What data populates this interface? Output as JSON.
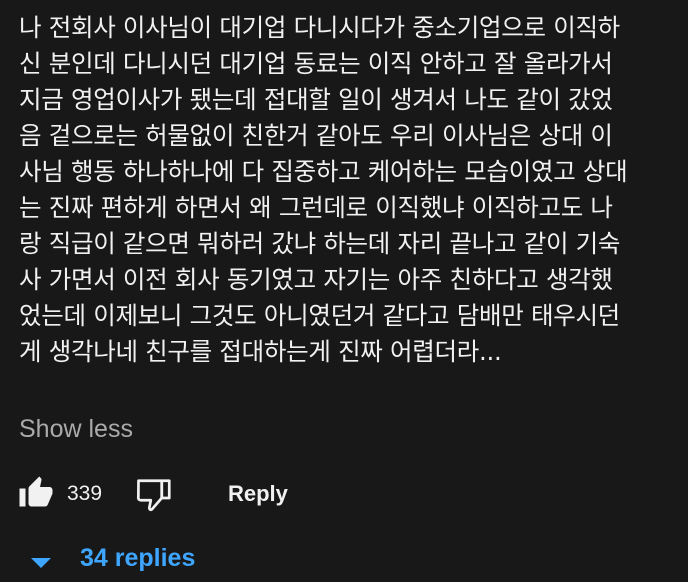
{
  "comment": {
    "lines": [
      "나 전회사 이사님이 대기업 다니시다가 중소기업으로 이직하",
      "신 분인데 다니시던 대기업 동료는 이직 안하고 잘 올라가서",
      "지금 영업이사가 됐는데 접대할 일이 생겨서 나도 같이 갔었",
      "음 겉으로는 허물없이 친한거 같아도 우리 이사님은 상대 이",
      "사님 행동 하나하나에 다 집중하고 케어하는 모습이였고 상대",
      "는 진짜 편하게 하면서 왜 그런데로 이직했냐 이직하고도 나",
      "랑 직급이 같으면 뭐하러 갔냐 하는데 자리 끝나고 같이 기숙",
      "사 가면서 이전 회사 동기였고 자기는 아주 친하다고 생각했",
      "었는데 이제보니 그것도 아니였던거 같다고 담배만 태우시던",
      "게 생각나네 친구를 접대하는게 진짜 어렵더라..."
    ],
    "show_less_label": "Show less"
  },
  "actions": {
    "like_icon": "thumbs-up-filled-icon",
    "like_count": "339",
    "dislike_icon": "thumbs-down-outline-icon",
    "reply_label": "Reply"
  },
  "replies": {
    "icon": "chevron-down-icon",
    "label": "34 replies",
    "accent_color": "#3ea6ff"
  },
  "colors": {
    "background": "#181818",
    "text": "#f1f1f1",
    "muted": "#aaaaaa",
    "accent": "#3ea6ff"
  }
}
